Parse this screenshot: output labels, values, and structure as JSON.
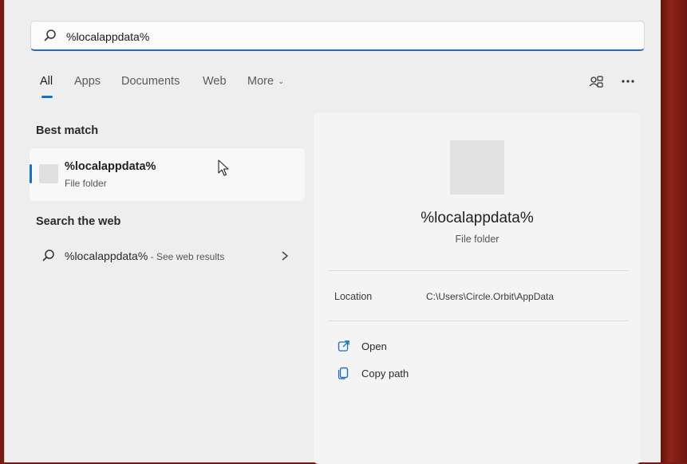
{
  "search": {
    "query": "%localappdata%"
  },
  "tabs": [
    {
      "label": "All",
      "active": true
    },
    {
      "label": "Apps"
    },
    {
      "label": "Documents"
    },
    {
      "label": "Web"
    },
    {
      "label": "More"
    }
  ],
  "header_icons": [
    "account-switch-icon",
    "more-options-icon"
  ],
  "best_match": {
    "section_title": "Best match",
    "title": "%localappdata%",
    "subtitle": "File folder"
  },
  "web_search": {
    "section_title": "Search the web",
    "query": "%localappdata%",
    "hint": " - See web results"
  },
  "detail": {
    "title": "%localappdata%",
    "subtitle": "File folder",
    "location_label": "Location",
    "location_value": "C:\\Users\\Circle.Orbit\\AppData",
    "actions": [
      {
        "label": "Open",
        "icon": "open-external-icon"
      },
      {
        "label": "Copy path",
        "icon": "copy-path-icon"
      }
    ]
  },
  "colors": {
    "accent": "#1a6fc0",
    "panel_bg": "#eeeeee",
    "desktop_bg": "#7a1a14"
  }
}
